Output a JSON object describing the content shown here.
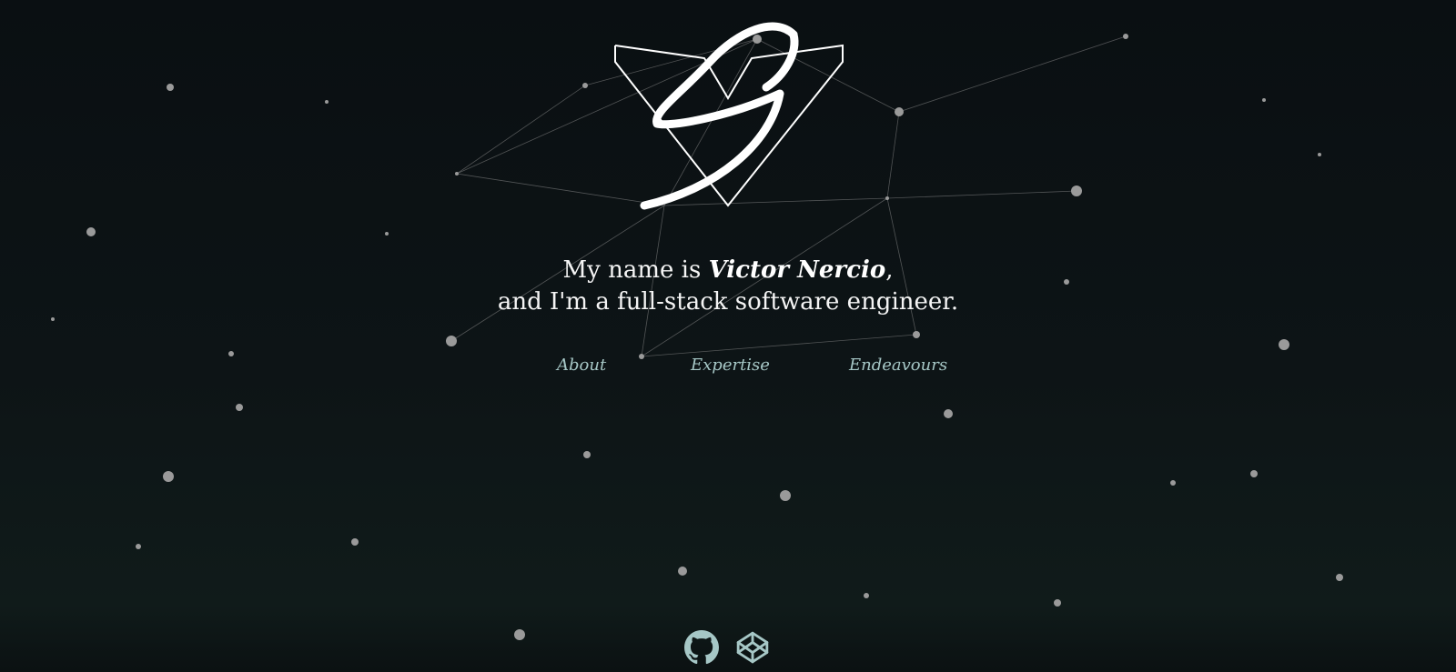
{
  "headline": {
    "intro": "My name is ",
    "name": "Victor Nercio",
    "comma": ",",
    "line2": "and I'm a full-stack software engineer."
  },
  "nav": {
    "about": "About",
    "expertise": "Expertise",
    "endeavours": "Endeavours"
  },
  "social": [
    "github-icon",
    "codepen-icon"
  ],
  "colors": {
    "accent": "#a6c7c6",
    "text": "#ffffff",
    "star": "#9a9a9a",
    "background": "#0c1214"
  }
}
